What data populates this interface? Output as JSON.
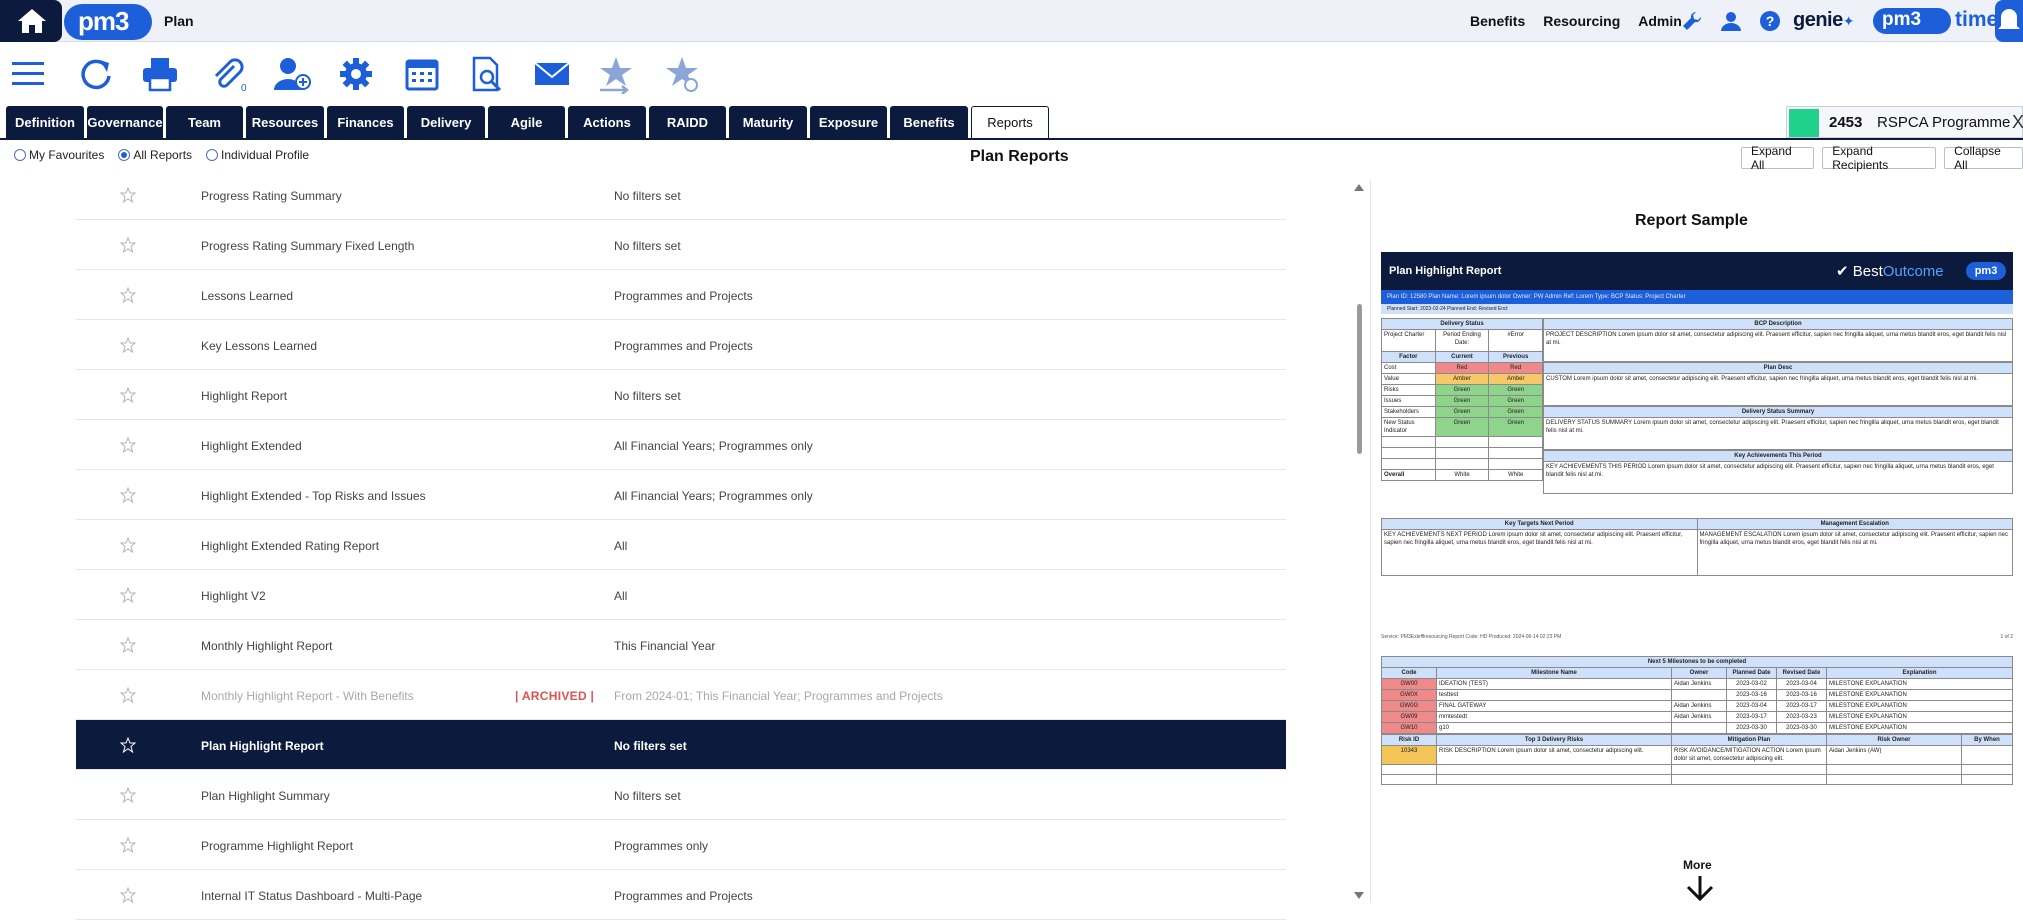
{
  "header": {
    "logo_text": "pm3",
    "app_title": "Plan",
    "links": [
      "Benefits",
      "Resourcing",
      "Admin"
    ],
    "genie_text": "genie",
    "time_logo_text": "pm3",
    "time_text": "time",
    "icons": [
      "home-icon",
      "wrench-icon",
      "user-icon",
      "help-icon",
      "bell-icon"
    ]
  },
  "toolbar": {
    "icons": [
      "menu-icon",
      "refresh-icon",
      "print-icon",
      "attachment-icon",
      "add-user-icon",
      "settings-icon",
      "calendar-icon",
      "search-document-icon",
      "email-icon",
      "star-export-icon",
      "star-refresh-icon"
    ],
    "attachment_count": "0"
  },
  "tabs": [
    {
      "label": "Definition",
      "active": false
    },
    {
      "label": "Governance",
      "active": false
    },
    {
      "label": "Team",
      "active": false
    },
    {
      "label": "Resources",
      "active": false
    },
    {
      "label": "Finances",
      "active": false
    },
    {
      "label": "Delivery",
      "active": false
    },
    {
      "label": "Agile",
      "active": false
    },
    {
      "label": "Actions",
      "active": false
    },
    {
      "label": "RAIDD",
      "active": false
    },
    {
      "label": "Maturity",
      "active": false
    },
    {
      "label": "Exposure",
      "active": false
    },
    {
      "label": "Benefits",
      "active": false
    },
    {
      "label": "Reports",
      "active": true
    }
  ],
  "programme": {
    "number": "2453",
    "name": "RSPCA Programme",
    "close": "X",
    "status_color": "#1fd18a"
  },
  "filters": {
    "options": [
      {
        "label": "My Favourites",
        "selected": false
      },
      {
        "label": "All Reports",
        "selected": true
      },
      {
        "label": "Individual Profile",
        "selected": false
      }
    ]
  },
  "page_title": "Plan Reports",
  "buttons": {
    "expand_all": "Expand All",
    "expand_recipients": "Expand Recipients",
    "collapse_all": "Collapse All"
  },
  "reports": [
    {
      "name": "Progress Rating Summary",
      "filters": "No filters set",
      "badge": "",
      "state": "normal"
    },
    {
      "name": "Progress Rating Summary Fixed Length",
      "filters": "No filters set",
      "badge": "",
      "state": "normal"
    },
    {
      "name": "Lessons Learned",
      "filters": "Programmes and Projects",
      "badge": "",
      "state": "normal"
    },
    {
      "name": "Key Lessons Learned",
      "filters": "Programmes and Projects",
      "badge": "",
      "state": "normal"
    },
    {
      "name": "Highlight Report",
      "filters": "No filters set",
      "badge": "",
      "state": "normal"
    },
    {
      "name": "Highlight Extended",
      "filters": "All Financial Years; Programmes only",
      "badge": "",
      "state": "normal"
    },
    {
      "name": "Highlight Extended - Top Risks and Issues",
      "filters": "All Financial Years; Programmes only",
      "badge": "",
      "state": "normal"
    },
    {
      "name": "Highlight Extended Rating Report",
      "filters": "All",
      "badge": "",
      "state": "normal"
    },
    {
      "name": "Highlight V2",
      "filters": "All",
      "badge": "",
      "state": "normal"
    },
    {
      "name": "Monthly Highlight Report",
      "filters": "This Financial Year",
      "badge": "",
      "state": "normal"
    },
    {
      "name": "Monthly Highlight Report - With Benefits",
      "filters": "From 2024-01; This Financial Year; Programmes and Projects",
      "badge": "| ARCHIVED |",
      "state": "archived"
    },
    {
      "name": "Plan Highlight Report",
      "filters": "No filters set",
      "badge": "",
      "state": "selected"
    },
    {
      "name": "Plan Highlight Summary",
      "filters": "No filters set",
      "badge": "",
      "state": "normal"
    },
    {
      "name": "Programme Highlight Report",
      "filters": "Programmes only",
      "badge": "",
      "state": "normal"
    },
    {
      "name": "Internal IT Status Dashboard - Multi-Page",
      "filters": "Programmes and Projects",
      "badge": "",
      "state": "normal"
    }
  ],
  "sample": {
    "title": "Report Sample",
    "more_label": "More",
    "doc": {
      "title": "Plan Highlight Report",
      "brand_a": "Best",
      "brand_b": "Outcome",
      "brand_pill": "pm3",
      "meta": "Plan ID: 12580     Plan Name: Lorem ipsum dolor     Owner: PW Admin     Ref: Lorem     Type: BCP     Status: Project Charter",
      "meta2": "Planned Start: 2023-02-24     Planned End:     Revised End:",
      "delivery_status": "Delivery Status",
      "col_project_charter": "Project Charter",
      "col_period_ending": "Period Ending Date:",
      "col_error": "#Error",
      "factor": "Factor",
      "current": "Current",
      "previous": "Previous",
      "factors": [
        {
          "name": "Cost",
          "current": "Red",
          "previous": "Red",
          "c": "red",
          "p": "red"
        },
        {
          "name": "Value",
          "current": "Amber",
          "previous": "Amber",
          "c": "amber",
          "p": "amber"
        },
        {
          "name": "Risks",
          "current": "Green",
          "previous": "Green",
          "c": "green",
          "p": "green"
        },
        {
          "name": "Issues",
          "current": "Green",
          "previous": "Green",
          "c": "green",
          "p": "green"
        },
        {
          "name": "Stakeholders",
          "current": "Green",
          "previous": "Green",
          "c": "green",
          "p": "green"
        },
        {
          "name": "New Status Indicator",
          "current": "Green",
          "previous": "Green",
          "c": "green",
          "p": "green"
        }
      ],
      "overall": "Overall",
      "overall_current": "White",
      "overall_previous": "White",
      "sections": [
        {
          "title": "BCP Description",
          "body": "PROJECT DESCRIPTION Lorem ipsum dolor sit amet, consectetur adipiscing elit. Praesent efficitur, sapien nec fringilla aliquet, urna metus blandit eros, eget blandit felis nisl at mi."
        },
        {
          "title": "Plan Desc",
          "body": "CUSTOM Lorem ipsum dolor sit amet, consectetur adipiscing elit. Praesent efficitur, sapien nec fringilla aliquet, urna metus blandit eros, eget blandit felis nisl at mi."
        },
        {
          "title": "Delivery Status Summary",
          "body": "DELIVERY STATUS SUMMARY Lorem ipsum dolor sit amet, consectetur adipiscing elit. Praesent efficitur, sapien nec fringilla aliquet, urna metus blandit eros, eget blandit felis nisl at mi."
        },
        {
          "title": "Key Achievements This Period",
          "body": "KEY ACHIEVEMENTS THIS PERIOD Lorem ipsum dolor sit amet, consectetur adipiscing elit. Praesent efficitur, sapien nec fringilla aliquet, urna metus blandit eros, eget blandit felis nisl at mi."
        }
      ],
      "key_targets_title": "Key Targets Next Period",
      "key_targets_body": "KEY ACHIEVEMENTS NEXT PERIOD Lorem ipsum dolor sit amet, consectetur adipiscing elit. Praesent efficitur, sapien nec fringilla aliquet, urna metus blandit eros, eget blandit felis nisl at mi.",
      "mgmt_title": "Management Escalation",
      "mgmt_body": "MANAGEMENT ESCALATION Lorem ipsum dolor sit amet, consectetur adipiscing elit. Praesent efficitur, sapien nec fringilla aliquet, urna metus blandit eros, eget blandit felis nisl at mi.",
      "footer_left": "Service: PM3Exlefflresourcing     Report Code: HD     Produced: 2024-06-14 02:23 PM",
      "footer_right": "1 of 2",
      "milestones_title": "Next 5 Milestones to be completed",
      "ms_headers": [
        "Code",
        "Milestone Name",
        "Owner",
        "Planned Date",
        "Revised Date",
        "Explanation"
      ],
      "milestones": [
        {
          "code": "GW00",
          "name": "IDEATION (TEST)",
          "owner": "Aidan Jenkins",
          "planned": "2023-03-02",
          "revised": "2023-03-04",
          "expl": "MILESTONE EXPLANATION"
        },
        {
          "code": "GW0X",
          "name": "testtest",
          "owner": "",
          "planned": "2023-03-16",
          "revised": "2023-03-16",
          "expl": "MILESTONE EXPLANATION"
        },
        {
          "code": "GW0G",
          "name": "FINAL GATEWAY",
          "owner": "Aidan Jenkins",
          "planned": "2023-03-04",
          "revised": "2023-03-17",
          "expl": "MILESTONE EXPLANATION"
        },
        {
          "code": "GW09",
          "name": "mmtestedt",
          "owner": "Aidan Jenkins",
          "planned": "2023-03-17",
          "revised": "2023-03-23",
          "expl": "MILESTONE EXPLANATION"
        },
        {
          "code": "GW10",
          "name": "g10",
          "owner": "",
          "planned": "2023-03-30",
          "revised": "2023-03-30",
          "expl": "MILESTONE EXPLANATION"
        }
      ],
      "risk_headers": [
        "Risk ID",
        "Top 3 Delivery Risks",
        "Mitigation Plan",
        "Risk Owner",
        "By When"
      ],
      "risk": {
        "id": "10343",
        "desc": "RISK DESCRIPTION Lorem ipsum dolor sit amet, consectetur adipiscing elit.",
        "plan": "RISK AVOIDANCE/MITIGATION ACTION Lorem ipsum dolor sit amet, consectetur adipiscing elit.",
        "owner": "Aidan Jenkins (AW)",
        "when": ""
      }
    }
  }
}
